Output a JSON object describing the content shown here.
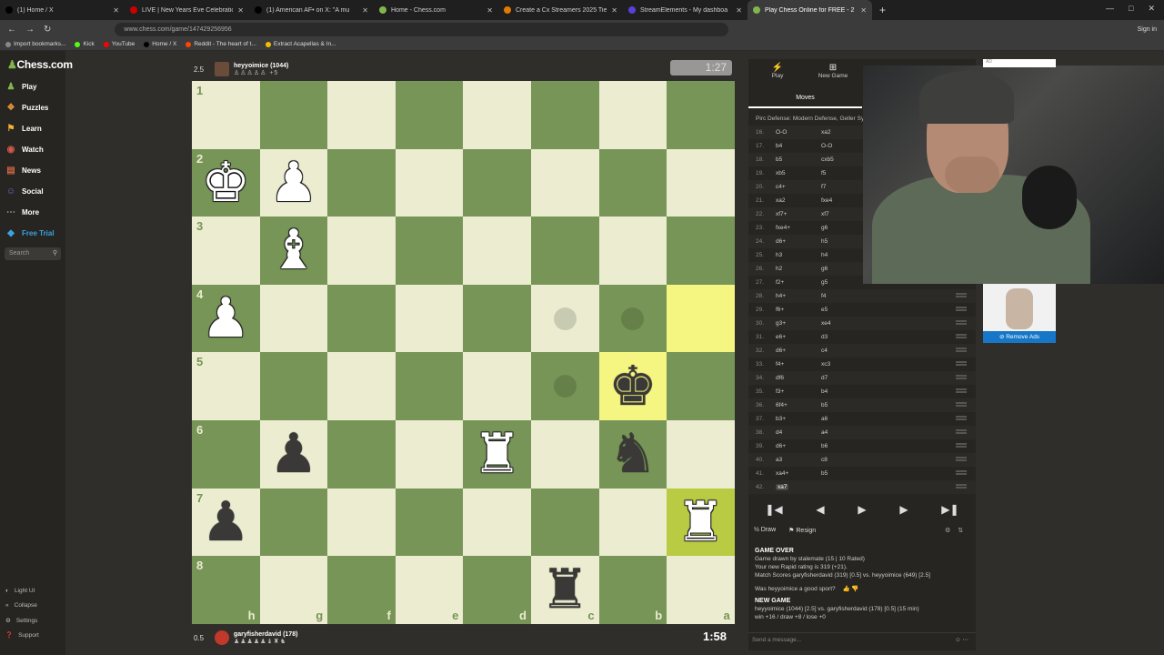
{
  "browser": {
    "tabs": [
      {
        "title": "(1) Home / X",
        "color": "#000000"
      },
      {
        "title": "LIVE | New Years Eve Celebratio",
        "color": "#cc0000"
      },
      {
        "title": "(1) American AF• on X: \"A mu",
        "color": "#000000"
      },
      {
        "title": "Home - Chess.com",
        "color": "#81b64c"
      },
      {
        "title": "Create a Cx Streamers 2025 Tie",
        "color": "#e07b00"
      },
      {
        "title": "StreamElements - My dashboa",
        "color": "#5b3fd6"
      },
      {
        "title": "Play Chess Online for FREE - 2",
        "color": "#81b64c"
      }
    ],
    "url": "www.chess.com/game/147429256956",
    "signin": "Sign in",
    "bookmarks": [
      {
        "label": "Import bookmarks...",
        "color": "#888888"
      },
      {
        "label": "Kick",
        "color": "#53fc18"
      },
      {
        "label": "YouTube",
        "color": "#ff0000"
      },
      {
        "label": "Home / X",
        "color": "#000000"
      },
      {
        "label": "Reddit - The heart of t...",
        "color": "#ff4500"
      },
      {
        "label": "Extract Acapellas & In...",
        "color": "#f0c000"
      }
    ]
  },
  "sidebar": {
    "logo": "Chess.com",
    "items": [
      {
        "label": "Play",
        "icon": "play-icon"
      },
      {
        "label": "Puzzles",
        "icon": "puzzle-icon"
      },
      {
        "label": "Learn",
        "icon": "learn-icon"
      },
      {
        "label": "Watch",
        "icon": "watch-icon"
      },
      {
        "label": "News",
        "icon": "news-icon"
      },
      {
        "label": "Social",
        "icon": "social-icon"
      },
      {
        "label": "More",
        "icon": "more-icon"
      },
      {
        "label": "Free Trial",
        "icon": "diamond-icon"
      }
    ],
    "search_placeholder": "Search",
    "footer": [
      "Light UI",
      "Collapse",
      "Settings",
      "Support"
    ]
  },
  "top_player": {
    "score": "2.5",
    "name": "heyyoimice (1044)",
    "material": "+5",
    "clock": "1:27"
  },
  "bottom_player": {
    "score": "0.5",
    "name": "garyfisherdavid (178)",
    "clock": "1:58"
  },
  "board": {
    "ranks": [
      "1",
      "2",
      "3",
      "4",
      "5",
      "6",
      "7",
      "8"
    ],
    "files": [
      "h",
      "g",
      "f",
      "e",
      "d",
      "c",
      "b",
      "a"
    ]
  },
  "panel": {
    "tabs": [
      {
        "label": "Play"
      },
      {
        "label": "New Game"
      }
    ],
    "moves_tab": "Moves",
    "opening": "Pirc Defense: Modern Defense, Geller Syst",
    "moves": [
      {
        "n": "16.",
        "w": "O-O",
        "b": "xa2"
      },
      {
        "n": "17.",
        "w": "b4",
        "b": "O-O"
      },
      {
        "n": "18.",
        "w": "b5",
        "b": "cxb5"
      },
      {
        "n": "19.",
        "w": "xb5",
        "b": "f5"
      },
      {
        "n": "20.",
        "w": "c4+",
        "b": "f7"
      },
      {
        "n": "21.",
        "w": "xa2",
        "b": "fxe4"
      },
      {
        "n": "22.",
        "w": "xf7+",
        "b": "xf7"
      },
      {
        "n": "23.",
        "w": "fxe4+",
        "b": "g6"
      },
      {
        "n": "24.",
        "w": "d6+",
        "b": "h5"
      },
      {
        "n": "25.",
        "w": "h3",
        "b": "h4"
      },
      {
        "n": "26.",
        "w": "h2",
        "b": "g6"
      },
      {
        "n": "27.",
        "w": "f2+",
        "b": "g5"
      },
      {
        "n": "28.",
        "w": "h4+",
        "b": "f4"
      },
      {
        "n": "29.",
        "w": "f6+",
        "b": "e5"
      },
      {
        "n": "30.",
        "w": "g3+",
        "b": "xe4"
      },
      {
        "n": "31.",
        "w": "e6+",
        "b": "d3"
      },
      {
        "n": "32.",
        "w": "d6+",
        "b": "c4"
      },
      {
        "n": "33.",
        "w": "f4+",
        "b": "xc3"
      },
      {
        "n": "34.",
        "w": "df6",
        "b": "d7"
      },
      {
        "n": "35.",
        "w": "f3+",
        "b": "b4"
      },
      {
        "n": "36.",
        "w": "6f4+",
        "b": "b5"
      },
      {
        "n": "37.",
        "w": "b3+",
        "b": "a6"
      },
      {
        "n": "38.",
        "w": "d4",
        "b": "a4"
      },
      {
        "n": "39.",
        "w": "d6+",
        "b": "b6"
      },
      {
        "n": "40.",
        "w": "a3",
        "b": "c8"
      },
      {
        "n": "41.",
        "w": "xa4+",
        "b": "b5"
      },
      {
        "n": "42.",
        "w": "xa7",
        "b": ""
      }
    ],
    "draw": "Draw",
    "resign": "Resign",
    "game_over": {
      "heading": "GAME OVER",
      "line1": "Game drawn by stalemate (15 | 10 Rated)",
      "line2": "Your new Rapid rating is 319 (+21).",
      "line3": "Match Scores garyfisherdavid (319) [0.5] vs. heyyoimice (649) [2.5]",
      "question": "Was heyyoimice a good sport?",
      "new_game": "NEW GAME",
      "line4": "heyyoimice (1044) [2.5] vs. garyfisherdavid (178) [0.5] (15 min)",
      "line5": "win +16 / draw +8 / lose +0"
    },
    "message_placeholder": "Send a message..."
  },
  "ads": {
    "remove_ads": "Remove Ads",
    "ad_label": "AD"
  }
}
